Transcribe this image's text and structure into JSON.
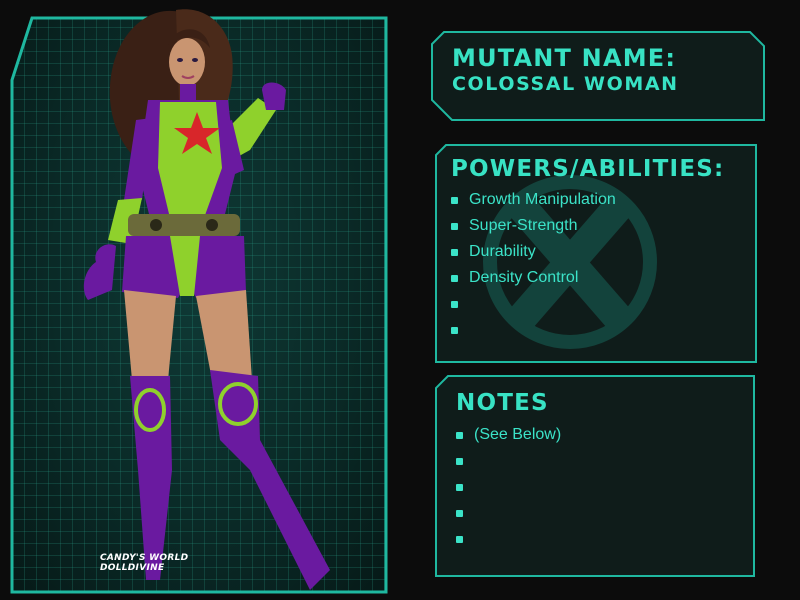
{
  "profile": {
    "name_label": "MUTANT NAME:",
    "name_value": "COLOSSAL WOMAN"
  },
  "powers": {
    "heading": "POWERS/ABILITIES:",
    "items": [
      "Growth Manipulation",
      "Super-Strength",
      "Durability",
      "Density Control",
      "",
      ""
    ]
  },
  "notes": {
    "heading": "NOTES",
    "items": [
      "(See Below)",
      "",
      "",
      "",
      ""
    ]
  },
  "credit": {
    "line1": "CANDY'S WORLD",
    "line2": "DOLLDIVINE"
  },
  "colors": {
    "accent": "#38e2c4",
    "frame": "#1fb8a0",
    "background": "#0c0c0c",
    "costume_purple": "#6a1aa0",
    "costume_green": "#8fd12c",
    "emblem_red": "#d8262a"
  },
  "icons": {
    "watermark": "x-emblem-icon"
  }
}
